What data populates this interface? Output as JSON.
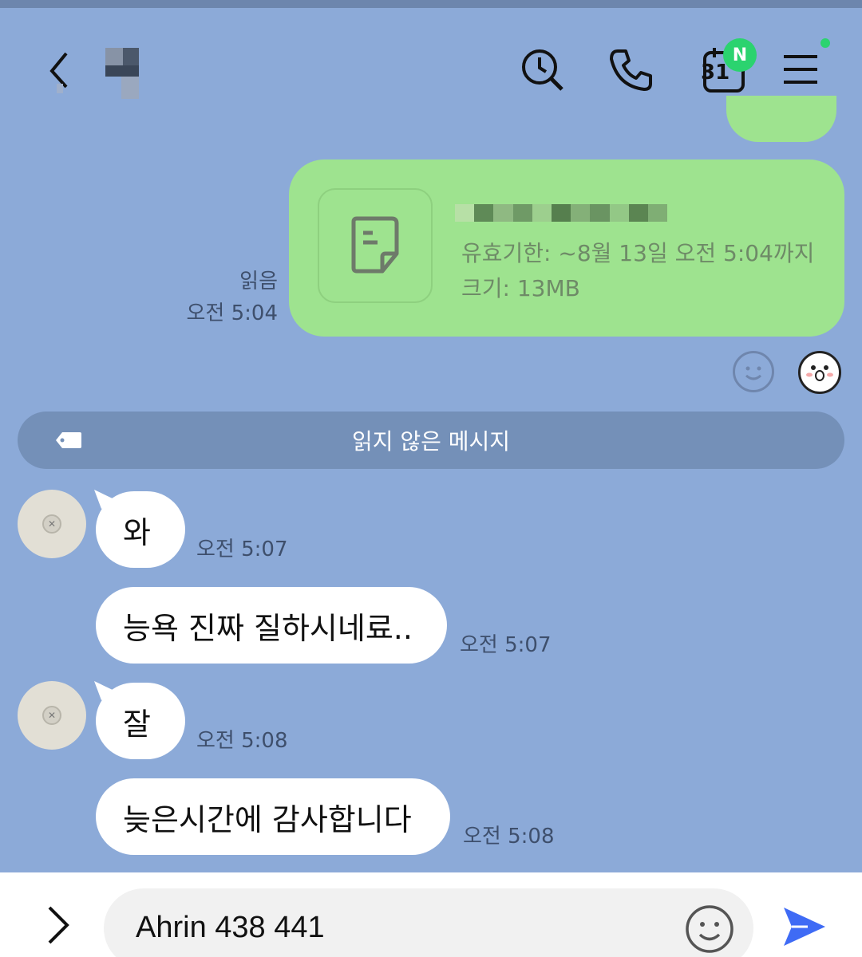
{
  "header": {
    "back_icon": "chevron-left-icon",
    "search_icon": "clock-search-icon",
    "call_icon": "phone-icon",
    "calendar_day": "31",
    "calendar_badge": "N",
    "menu_icon": "hamburger-menu-icon"
  },
  "file_message": {
    "expiry": "유효기한: ~8월 13일 오전 5:04까지",
    "size": "크기: 13MB",
    "read_status": "읽음",
    "time": "오전 5:04"
  },
  "divider": {
    "label": "읽지 않은 메시지"
  },
  "messages": [
    {
      "text": "와",
      "time": "오전 5:07"
    },
    {
      "text": "능욕 진짜 질하시네료..",
      "time": "오전 5:07"
    },
    {
      "text": "잘",
      "time": "오전 5:08"
    },
    {
      "text": "늦은시간에 감사합니다",
      "time": "오전 5:08"
    }
  ],
  "input": {
    "value": "Ahrin 438 441"
  },
  "colors": {
    "background": "#8caad8",
    "sent_bubble": "#9ee38f",
    "badge": "#2bd36f",
    "send_icon": "#3f6bf5"
  }
}
